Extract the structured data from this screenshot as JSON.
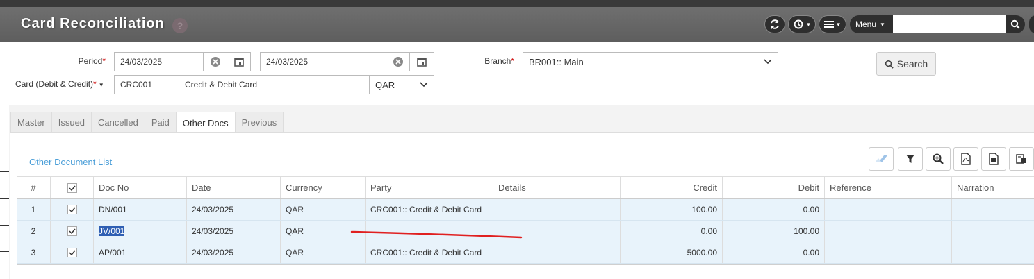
{
  "page": {
    "title": "Card Reconciliation",
    "help_glyph": "?"
  },
  "header": {
    "menu_label": "Menu",
    "search_value": ""
  },
  "form": {
    "period_label": "Period",
    "period_from": "24/03/2025",
    "period_to": "24/03/2025",
    "card_label": "Card (Debit & Credit)",
    "card_code": "CRC001",
    "card_name": "Credit & Debit Card",
    "currency": "QAR",
    "branch_label": "Branch",
    "branch_value": "BR001:: Main",
    "required_mark": "*",
    "search_button": "Search"
  },
  "tabs": [
    {
      "label": "Master"
    },
    {
      "label": "Issued"
    },
    {
      "label": "Cancelled"
    },
    {
      "label": "Paid"
    },
    {
      "label": "Other Docs",
      "active": true
    },
    {
      "label": "Previous"
    }
  ],
  "panel": {
    "title": "Other Document List"
  },
  "table": {
    "headers": [
      "#",
      "",
      "Doc No",
      "Date",
      "Currency",
      "Party",
      "Details",
      "Credit",
      "Debit",
      "Reference",
      "Narration"
    ],
    "rows": [
      {
        "num": "1",
        "doc": "DN/001",
        "date": "24/03/2025",
        "currency": "QAR",
        "party": "CRC001:: Credit & Debit Card",
        "details": "",
        "credit": "100.00",
        "debit": "0.00",
        "reference": "",
        "narration": ""
      },
      {
        "num": "2",
        "doc": "JV/001",
        "date": "24/03/2025",
        "currency": "QAR",
        "party": "",
        "details": "",
        "credit": "0.00",
        "debit": "100.00",
        "reference": "",
        "narration": ""
      },
      {
        "num": "3",
        "doc": "AP/001",
        "date": "24/03/2025",
        "currency": "QAR",
        "party": "CRC001:: Credit & Debit Card",
        "details": "",
        "credit": "5000.00",
        "debit": "0.00",
        "reference": "",
        "narration": ""
      }
    ]
  },
  "colors": {
    "accent": "#4a9ed8",
    "row_bg": "#e8f3fb",
    "header_bg": "#666666",
    "annotation": "#e02020"
  }
}
